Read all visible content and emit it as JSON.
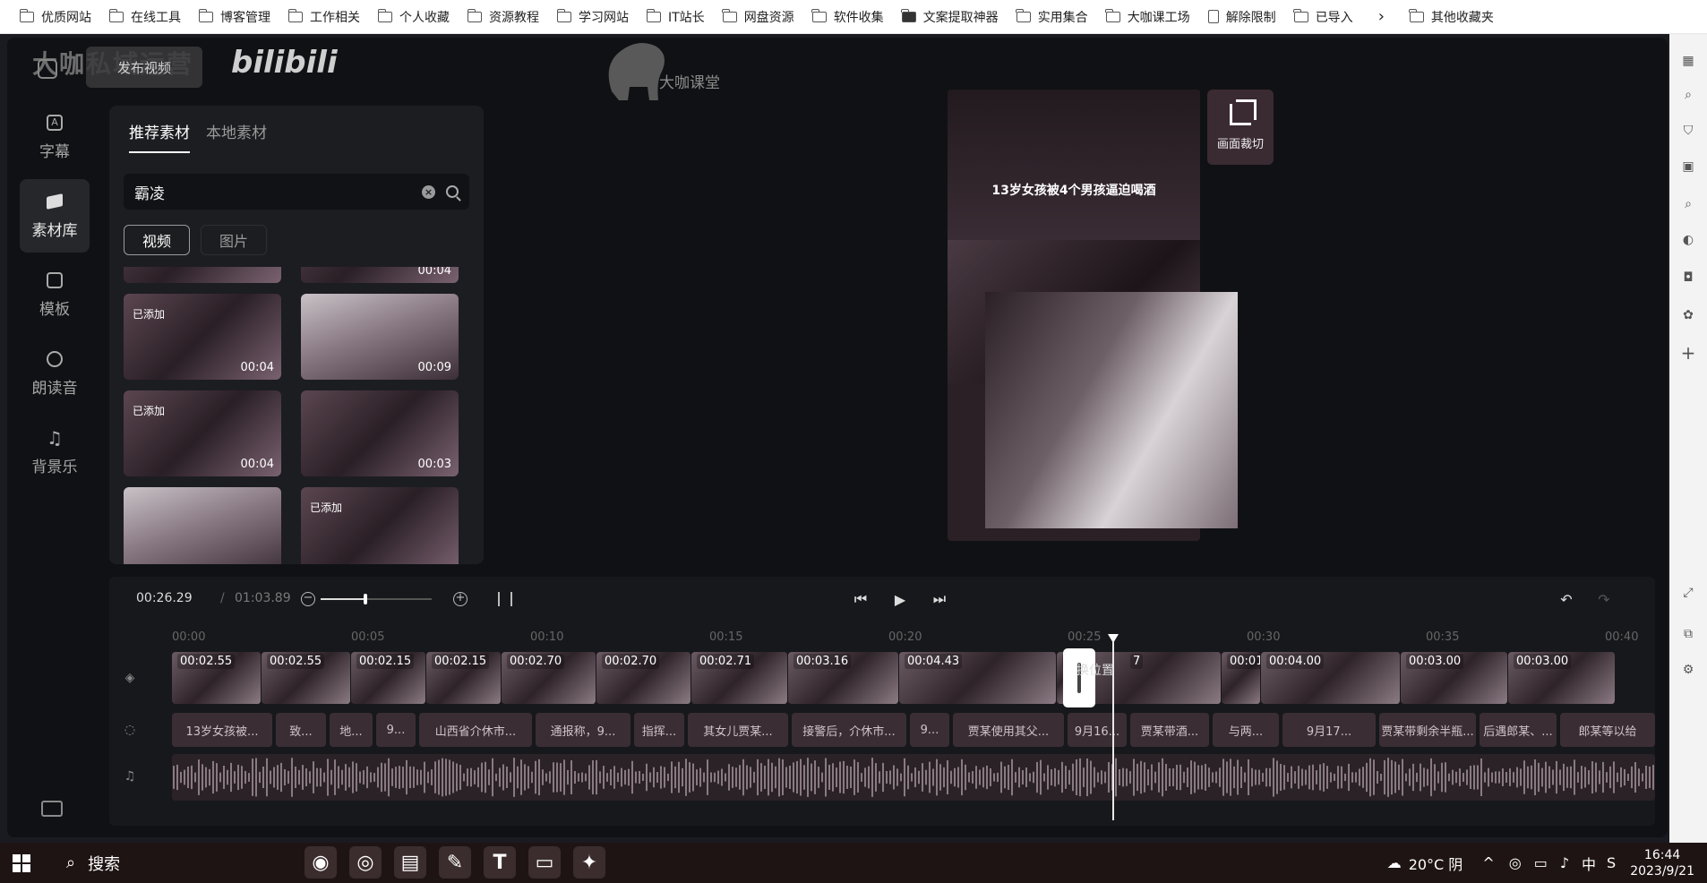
{
  "bookmarks": [
    "优质网站",
    "在线工具",
    "博客管理",
    "工作相关",
    "个人收藏",
    "资源教程",
    "学习网站",
    "IT站长",
    "网盘资源",
    "软件收集",
    "文案提取神器",
    "实用集合",
    "大咖课工场",
    "解除限制",
    "已导入",
    "其他收藏夹"
  ],
  "header": {
    "watermark": "大咖私域运营",
    "brand": "bilibili",
    "publish_label": "发布视频",
    "course_brand": "大咖课堂"
  },
  "nav": {
    "items": [
      {
        "label": "字幕",
        "icon": "subtitle-icon"
      },
      {
        "label": "素材库",
        "icon": "layers-icon"
      },
      {
        "label": "模板",
        "icon": "template-icon"
      },
      {
        "label": "朗读音",
        "icon": "voice-icon"
      },
      {
        "label": "背景乐",
        "icon": "music-icon"
      }
    ],
    "active_index": 1
  },
  "panel": {
    "tabs": [
      "推荐素材",
      "本地素材"
    ],
    "search_value": "霸凌",
    "type_tabs": [
      "视频",
      "图片"
    ],
    "thumbs": [
      {
        "added": "",
        "duration": "00:04"
      },
      {
        "added": "已添加",
        "duration": "00:04"
      },
      {
        "added": "",
        "duration": "00:09"
      },
      {
        "added": "已添加",
        "duration": "00:04"
      },
      {
        "added": "",
        "duration": "00:03"
      },
      {
        "added": "",
        "duration": ""
      },
      {
        "added": "已添加",
        "duration": ""
      }
    ]
  },
  "preview": {
    "title": "13岁女孩被4个男孩逼迫喝酒",
    "crop_label": "画面裁切"
  },
  "timeline": {
    "current_time": "00:26.29",
    "separator": "/",
    "total_time": "01:03.89",
    "zoom_level": 0.4,
    "ruler": [
      "00:00",
      "00:05",
      "00:10",
      "00:15",
      "00:20",
      "00:25",
      "00:30",
      "00:35",
      "00:40"
    ],
    "video_clips": [
      "00:02.55",
      "00:02.55",
      "00:02.15",
      "00:02.15",
      "00:02.70",
      "00:02.70",
      "00:02.71",
      "00:03.16",
      "00:04.43",
      "0",
      "7",
      "00:01",
      "00:04.00",
      "00:03.00",
      "00:03.00"
    ],
    "replace_tip": "换位置",
    "text_clips": [
      "13岁女孩被...",
      "致...",
      "地...",
      "9...",
      "山西省介休市...",
      "通报称，9...",
      "指挥...",
      "其女儿贾某...",
      "接警后，介休市...",
      "9...",
      "贾某使用其父...",
      "9月16...",
      "贾某带酒...",
      "与两...",
      "9月17...",
      "贾某带剩余半瓶...",
      "后遇郎某、...",
      "郎某等以给"
    ]
  },
  "taskbar": {
    "search_label": "搜索",
    "weather": "20°C 阴",
    "ime": "中",
    "time": "16:44",
    "date": "2023/9/21"
  }
}
